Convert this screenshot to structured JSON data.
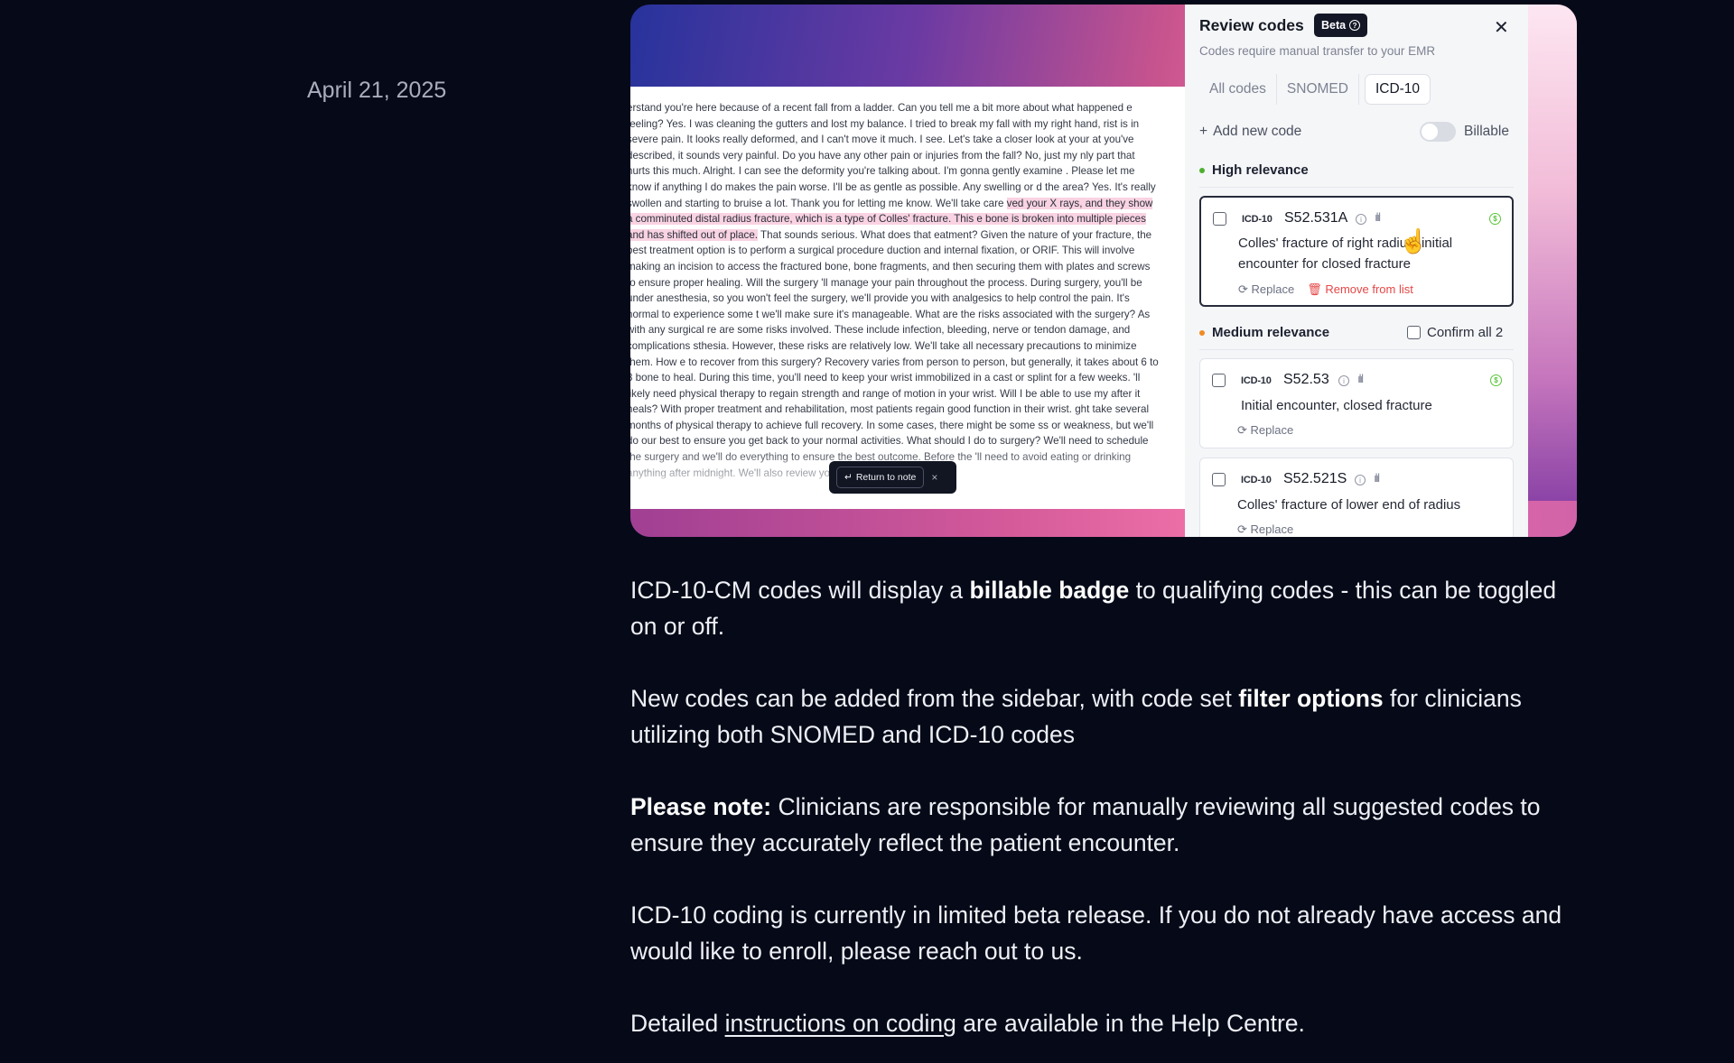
{
  "date": "April 21, 2025",
  "note": {
    "before": "erstand you're here because of a recent fall from a ladder. Can you tell me a bit more about what happened e feeling? Yes. I was cleaning the gutters and lost my balance. I tried to break my fall with my right hand, rist is in severe pain. It looks really deformed, and I can't move it much. I see. Let's take a closer look at your at you've described, it sounds very painful. Do you have any other pain or injuries from the fall? No, just my nly part that hurts this much. Alright. I can see the deformity you're talking about. I'm gonna gently examine . Please let me know if anything I do makes the pain worse. I'll be as gentle as possible. Any swelling or d the area? Yes. It's really swollen and starting to bruise a lot. Thank you for letting me know. We'll take care ",
    "highlight": "ved your X rays, and they show a comminuted distal radius fracture, which is a type of Colles' fracture. This e bone is broken into multiple pieces and has shifted out of place.",
    "after": " That sounds serious. What does that eatment? Given the nature of your fracture, the best treatment option is to perform a surgical procedure duction and internal fixation, or ORIF. This will involve making an incision to access the fractured bone, bone fragments, and then securing them with plates and screws to ensure proper healing. Will the surgery 'll manage your pain throughout the process. During surgery, you'll be under anesthesia, so you won't feel the surgery, we'll provide you with analgesics to help control the pain. It's normal to experience some t we'll make sure it's manageable. What are the risks associated with the surgery? As with any surgical re are some risks involved. These include infection, bleeding, nerve or tendon damage, and complications sthesia. However, these risks are relatively low. We'll take all necessary precautions to minimize them. How e to recover from this surgery? Recovery varies from person to person, but generally, it takes about 6 to 8 bone to heal. During this time, you'll need to keep your wrist immobilized in a cast or splint for a few weeks. 'll likely need physical therapy to regain strength and range of motion in your wrist. Will I be able to use my after it heals? With proper treatment and rehabilitation, most patients regain good function in their wrist. ght take several months of physical therapy to achieve full recovery. In some cases, there might be some ss or weakness, but we'll do our best to ensure you get back to your normal activities. What should I do to surgery? We'll need to schedule the surgery and we'll do everything to ensure the best outcome. Before the 'll need to avoid eating or drinking anything after midnight. We'll also review your medical history and",
    "return_label": "Return to note",
    "return_icon": "↵",
    "close_glyph": "×"
  },
  "review": {
    "title": "Review codes",
    "beta_label": "Beta",
    "subtitle": "Codes require manual transfer to your EMR",
    "tabs": [
      "All codes",
      "SNOMED",
      "ICD-10"
    ],
    "active_tab": "ICD-10",
    "add_code_label": "Add new code",
    "billable_label": "Billable",
    "billable_on": false,
    "high_label": "High relevance",
    "high_color": "#4caf2e",
    "medium_label": "Medium relevance",
    "medium_color": "#f08a24",
    "confirm_all_label": "Confirm all 2",
    "replace_label": "Replace",
    "remove_label": "Remove from list",
    "cards": [
      {
        "system": "ICD-10",
        "code": "S52.531A",
        "desc": "Colles' fracture of right radius, initial encounter for closed fracture",
        "billable": true
      },
      {
        "system": "ICD-10",
        "code": "S52.53",
        "desc": "Initial encounter, closed fracture",
        "billable": true
      },
      {
        "system": "ICD-10",
        "code": "S52.521S",
        "desc": "Colles' fracture of lower end of radius",
        "billable": false
      }
    ]
  },
  "article": {
    "p1_a": "ICD-10-CM codes will display a ",
    "p1_b": "billable badge",
    "p1_c": " to qualifying codes - this can be toggled on or off.",
    "p2_a": "New codes can be added from the sidebar, with code set ",
    "p2_b": "filter options",
    "p2_c": " for clinicians utilizing both SNOMED and ICD-10 codes",
    "p3_a": "Please note:",
    "p3_b": " Clinicians are responsible for manually reviewing all suggested codes to ensure they accurately reflect the patient encounter.",
    "p4": "ICD-10 coding is currently in limited beta release. If you do not already have access and would like to enroll, please reach out to us.",
    "p5_a": "Detailed ",
    "p5_link": "instructions on coding",
    "p5_c": " are available in the Help Centre."
  }
}
